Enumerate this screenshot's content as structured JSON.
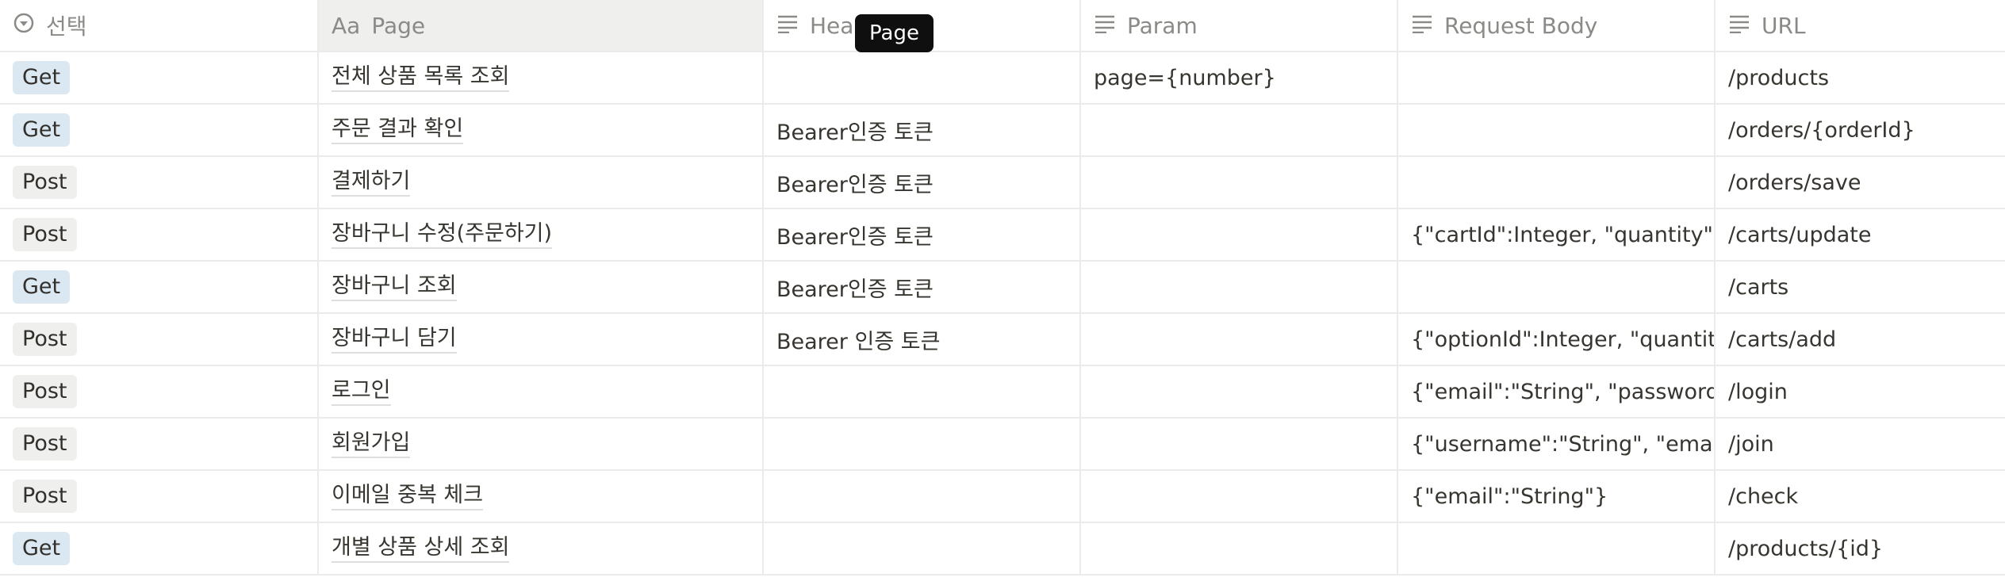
{
  "columns": [
    {
      "label": "선택",
      "icon": "select-circle-icon"
    },
    {
      "label": "Page",
      "prefix": "Aa",
      "icon": "title-icon"
    },
    {
      "label": "Header",
      "icon": "text-lines-icon"
    },
    {
      "label": "Param",
      "icon": "text-lines-icon"
    },
    {
      "label": "Request Body",
      "icon": "text-lines-icon"
    },
    {
      "label": "URL",
      "icon": "text-lines-icon"
    }
  ],
  "tooltip": "Page",
  "colors": {
    "get_tag": "#dbe8f2",
    "post_tag": "#efefed",
    "grid": "#ebebea",
    "header_text": "#8b8a86"
  },
  "rows": [
    {
      "method": "Get",
      "page": "전체 상품 목록 조회",
      "header": "",
      "param": "page={number}",
      "body": "",
      "url": "/products"
    },
    {
      "method": "Get",
      "page": "주문 결과 확인",
      "header": "Bearer인증 토큰",
      "param": "",
      "body": "",
      "url": "/orders/{orderId}"
    },
    {
      "method": "Post",
      "page": "결제하기",
      "header": "Bearer인증 토큰",
      "param": "",
      "body": "",
      "url": "/orders/save"
    },
    {
      "method": "Post",
      "page": "장바구니 수정(주문하기)",
      "header": "Bearer인증 토큰",
      "param": "",
      "body": "{\"cartId\":Integer, \"quantity\":Int",
      "url": "/carts/update"
    },
    {
      "method": "Get",
      "page": "장바구니 조회",
      "header": "Bearer인증 토큰",
      "param": "",
      "body": "",
      "url": "/carts"
    },
    {
      "method": "Post",
      "page": "장바구니 담기",
      "header": "Bearer 인증 토큰",
      "param": "",
      "body": "{\"optionId\":Integer, \"quantity\":",
      "url": "/carts/add"
    },
    {
      "method": "Post",
      "page": "로그인",
      "header": "",
      "param": "",
      "body": "{\"email\":\"String\", \"password\":\"",
      "url": "/login"
    },
    {
      "method": "Post",
      "page": "회원가입",
      "header": "",
      "param": "",
      "body": "{\"username\":\"String\", \"email\":\"",
      "url": "/join"
    },
    {
      "method": "Post",
      "page": "이메일 중복 체크",
      "header": "",
      "param": "",
      "body": "{\"email\":\"String\"}",
      "url": "/check"
    },
    {
      "method": "Get",
      "page": "개별 상품 상세 조회",
      "header": "",
      "param": "",
      "body": "",
      "url": "/products/{id}"
    }
  ]
}
